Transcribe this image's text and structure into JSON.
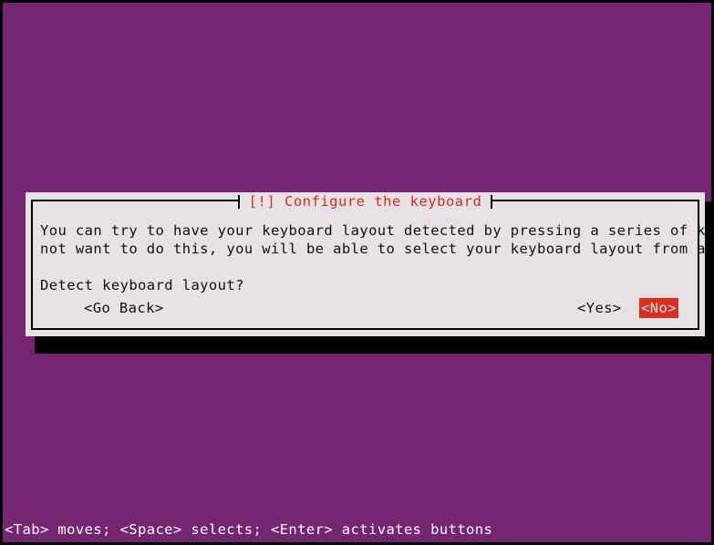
{
  "screen": {
    "background_color": "#762572",
    "border_color": "#000000"
  },
  "dialog": {
    "title": "[!] Configure the keyboard",
    "title_color": "#e02b1b",
    "background_color": "#e6e1e4",
    "border_color": "#000000",
    "shadow_color": "#000000",
    "body": {
      "paragraph_lines": [
        "You can try to have your keyboard layout detected by pressing a series of keys. If you do",
        "not want to do this, you will be able to select your keyboard layout from a list."
      ],
      "question": "Detect keyboard layout?"
    },
    "buttons": [
      {
        "name": "go-back",
        "label": "<Go Back>",
        "selected": false
      },
      {
        "name": "yes",
        "label": "<Yes>",
        "selected": false
      },
      {
        "name": "no",
        "label": "<No>",
        "selected": true,
        "highlight_bg": "#dd2e20",
        "highlight_fg": "#e6e1e4"
      }
    ]
  },
  "help_bar": {
    "text": "<Tab> moves; <Space> selects; <Enter> activates buttons",
    "text_color": "#ffffff"
  }
}
